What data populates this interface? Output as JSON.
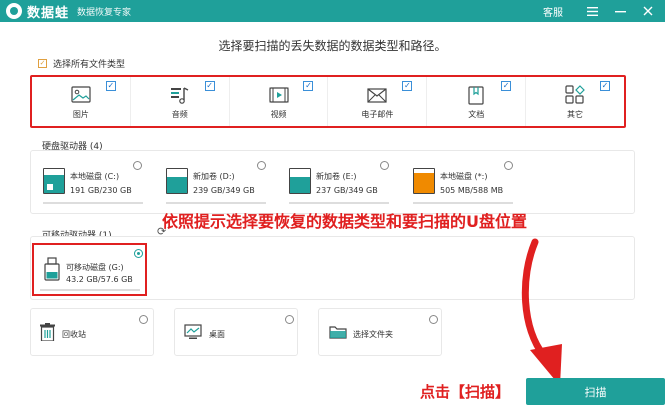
{
  "titlebar": {
    "app_name": "数据蛙",
    "app_subtitle": "数据恢复专家",
    "support": "客服",
    "menu_icon": "hamburger-icon",
    "minimize_icon": "minimize-icon",
    "close_icon": "close-icon"
  },
  "instruction": "选择要扫描的丢失数据的数据类型和路径。",
  "select_all": {
    "label": "选择所有文件类型",
    "checked": true
  },
  "file_types": [
    {
      "label": "图片",
      "icon": "image-icon",
      "checked": true
    },
    {
      "label": "音频",
      "icon": "audio-icon",
      "checked": true
    },
    {
      "label": "视频",
      "icon": "video-icon",
      "checked": true
    },
    {
      "label": "电子邮件",
      "icon": "email-icon",
      "checked": true
    },
    {
      "label": "文档",
      "icon": "document-icon",
      "checked": true
    },
    {
      "label": "其它",
      "icon": "other-icon",
      "checked": true
    }
  ],
  "hard_drives": {
    "title": "硬盘驱动器 (4)",
    "items": [
      {
        "name": "本地磁盘 (C:)",
        "size": "191 GB/230 GB",
        "fill_color": "#1fa09a",
        "used_fraction": 0.83,
        "system": true
      },
      {
        "name": "新加卷 (D:)",
        "size": "239 GB/349 GB",
        "fill_color": "#1fa09a",
        "used_fraction": 0.68,
        "system": false
      },
      {
        "name": "新加卷 (E:)",
        "size": "237 GB/349 GB",
        "fill_color": "#1fa09a",
        "used_fraction": 0.68,
        "system": false
      },
      {
        "name": "本地磁盘 (*:)",
        "size": "505 MB/588 MB",
        "fill_color": "#f08a00",
        "used_fraction": 0.86,
        "system": false
      }
    ]
  },
  "removable": {
    "title": "可移动驱动器 (1)",
    "items": [
      {
        "name": "可移动磁盘 (G:)",
        "size": "43.2 GB/57.6 GB",
        "selected": true
      }
    ]
  },
  "annotation_main": "依照提示选择要恢复的数据类型和要扫描的U盘位置",
  "locations": [
    {
      "label": "回收站",
      "icon": "recycle-bin-icon"
    },
    {
      "label": "桌面",
      "icon": "desktop-icon"
    },
    {
      "label": "选择文件夹",
      "icon": "folder-icon"
    }
  ],
  "annotation_scan": "点击【扫描】",
  "scan_button": "扫描",
  "colors": {
    "accent": "#1fa09a",
    "annotation": "#e02020",
    "orange": "#f08a00"
  }
}
